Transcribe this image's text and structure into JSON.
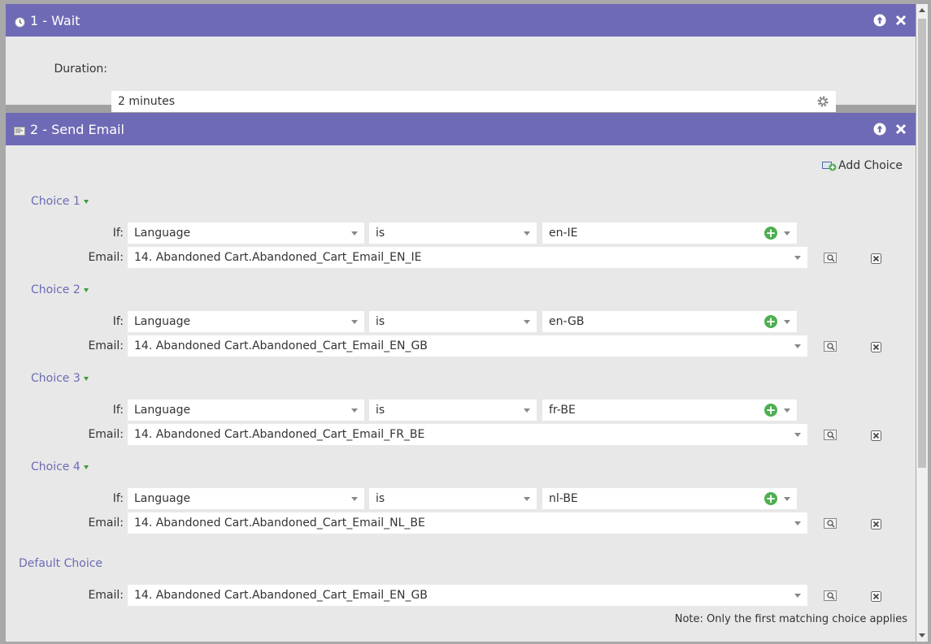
{
  "wait": {
    "title": "1 - Wait",
    "duration_label": "Duration:",
    "duration_value": "2 minutes"
  },
  "send": {
    "title": "2 - Send Email",
    "add_choice_label": "Add Choice",
    "choices": [
      {
        "title": "Choice 1",
        "if_label": "If:",
        "attribute": "Language",
        "operator": "is",
        "value": "en-IE",
        "email_label": "Email:",
        "email": "14. Abandoned Cart.Abandoned_Cart_Email_EN_IE"
      },
      {
        "title": "Choice 2",
        "if_label": "If:",
        "attribute": "Language",
        "operator": "is",
        "value": "en-GB",
        "email_label": "Email:",
        "email": "14. Abandoned Cart.Abandoned_Cart_Email_EN_GB"
      },
      {
        "title": "Choice 3",
        "if_label": "If:",
        "attribute": "Language",
        "operator": "is",
        "value": "fr-BE",
        "email_label": "Email:",
        "email": "14. Abandoned Cart.Abandoned_Cart_Email_FR_BE"
      },
      {
        "title": "Choice 4",
        "if_label": "If:",
        "attribute": "Language",
        "operator": "is",
        "value": "nl-BE",
        "email_label": "Email:",
        "email": "14. Abandoned Cart.Abandoned_Cart_Email_NL_BE"
      }
    ],
    "default_title": "Default Choice",
    "default_email_label": "Email:",
    "default_email": "14. Abandoned Cart.Abandoned_Cart_Email_EN_GB",
    "note": "Note: Only the first matching choice applies"
  },
  "colors": {
    "header": "#6f6ab5",
    "choice_title": "#6b6bb5",
    "panel": "#e8e8e8"
  },
  "icons": {
    "wait": "clock-icon",
    "send": "email-icon",
    "move_up": "arrow-up-icon",
    "close": "close-icon",
    "gear": "gear-icon",
    "preview": "preview-icon",
    "delete": "delete-icon",
    "add": "plus-icon"
  }
}
